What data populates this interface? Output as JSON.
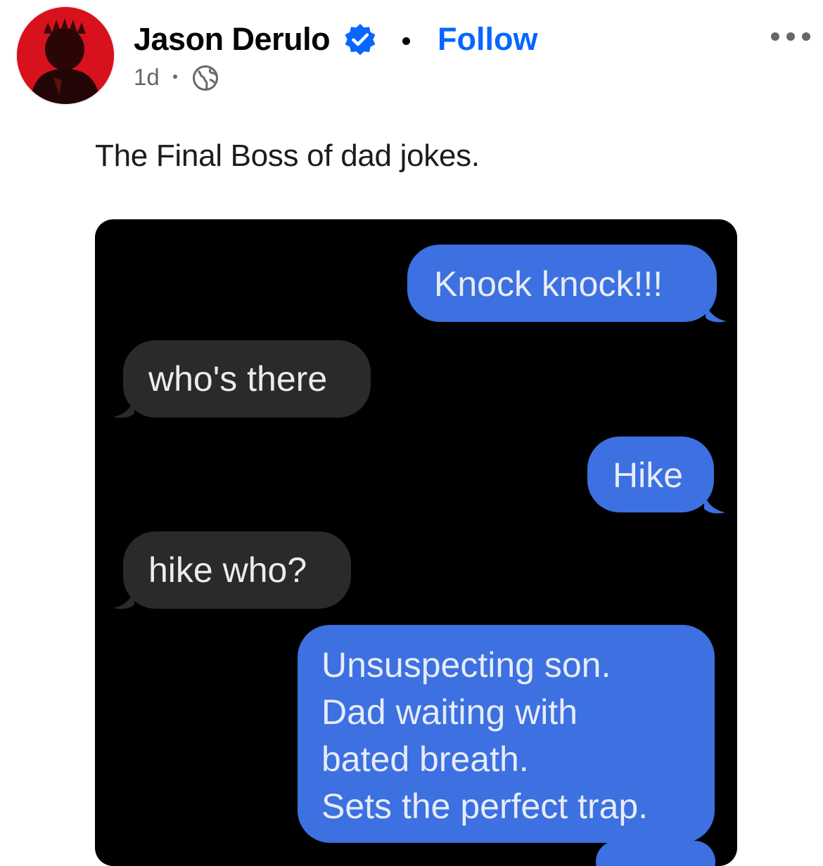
{
  "post": {
    "author": "Jason Derulo",
    "verified": true,
    "follow_label": "Follow",
    "time": "1d",
    "audience_icon": "globe-icon",
    "more_icon": "more-options-icon",
    "caption": "The Final Boss of dad jokes."
  },
  "colors": {
    "follow": "#0866ff",
    "verified_badge": "#0866ff",
    "sent_bubble": "#3d70e0",
    "received_bubble": "#2a2a2c",
    "chat_background": "#000000"
  },
  "chat": {
    "messages": [
      {
        "side": "sent",
        "text": "Knock knock!!!"
      },
      {
        "side": "received",
        "text": "who's there"
      },
      {
        "side": "sent",
        "text": "Hike"
      },
      {
        "side": "received",
        "text": "hike who?"
      },
      {
        "side": "sent",
        "lines": [
          "Unsuspecting son.",
          "Dad waiting with",
          "bated breath.",
          "Sets the perfect trap."
        ]
      }
    ]
  }
}
